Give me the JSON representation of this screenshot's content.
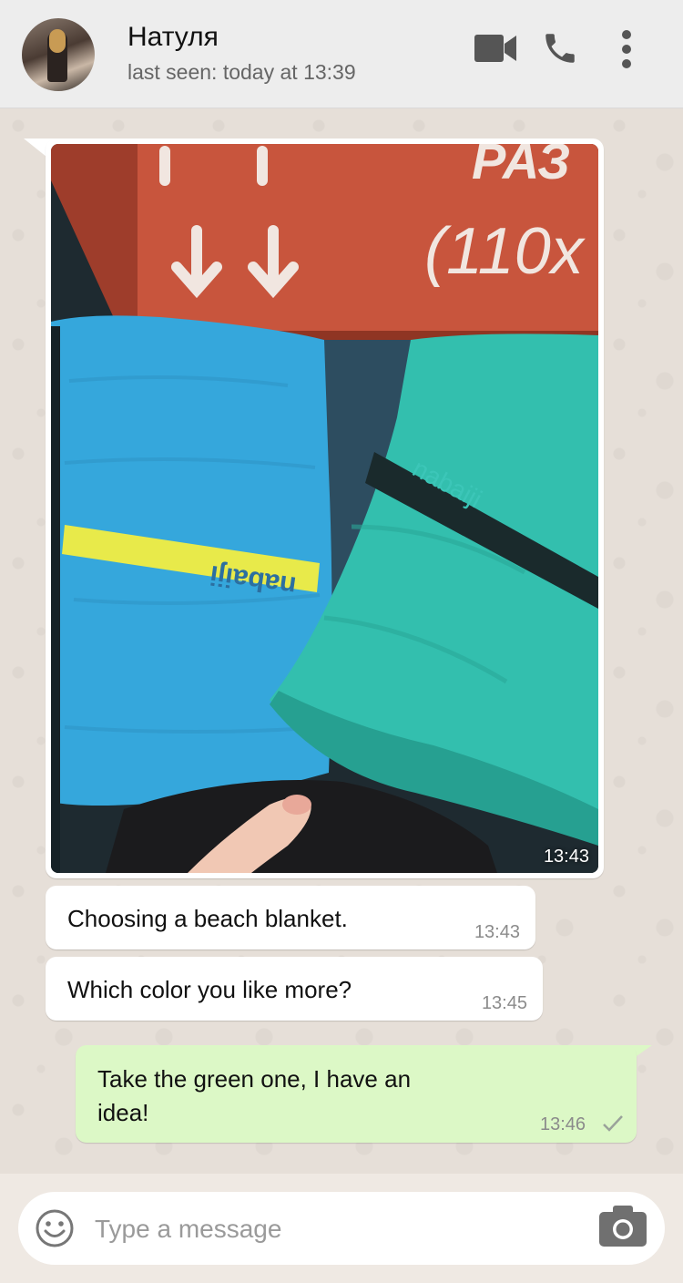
{
  "header": {
    "contact_name": "Натуля",
    "last_seen": "last seen: today at 13:39"
  },
  "messages": [
    {
      "type": "image",
      "direction": "incoming",
      "time": "13:43",
      "image_desc": "photo-towels"
    },
    {
      "type": "text",
      "direction": "incoming",
      "text": "Choosing a beach blanket.",
      "time": "13:43"
    },
    {
      "type": "text",
      "direction": "incoming",
      "text": "Which color you like more?",
      "time": "13:45"
    },
    {
      "type": "text",
      "direction": "outgoing",
      "text_line1": "Take the green one, I have an",
      "text_line2": "idea!",
      "time": "13:46",
      "status": "sent"
    }
  ],
  "photo": {
    "sign_text_1": "РАЗ",
    "sign_text_2": "(110х",
    "band_text_left": "nabaiji",
    "band_text_right": "nabaiji"
  },
  "input": {
    "placeholder": "Type a message"
  },
  "colors": {
    "incoming_bubble": "#ffffff",
    "outgoing_bubble": "#dcf8c6",
    "header_bg": "#ededed",
    "icon_gray": "#555555"
  },
  "icons": [
    "video-call-icon",
    "voice-call-icon",
    "more-menu-icon",
    "emoji-icon",
    "camera-icon",
    "check-icon"
  ]
}
